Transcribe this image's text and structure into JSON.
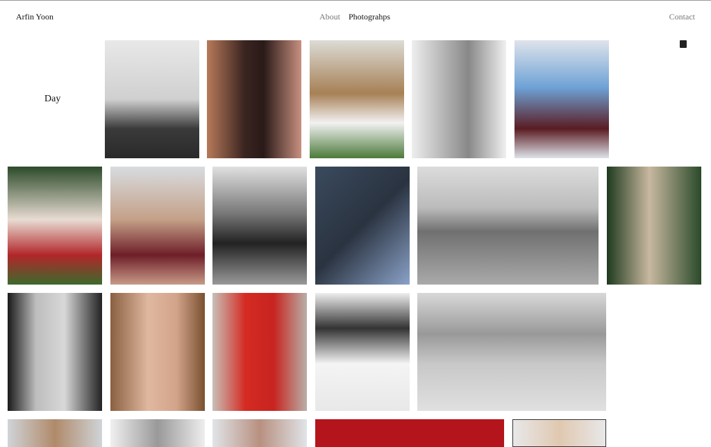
{
  "header": {
    "brand": "Arfin Yoon",
    "nav": [
      "About",
      "Photograhps"
    ],
    "contact": "Contact"
  },
  "section": {
    "title": "Day"
  },
  "icons": {
    "grid_toggle": "square-icon"
  }
}
